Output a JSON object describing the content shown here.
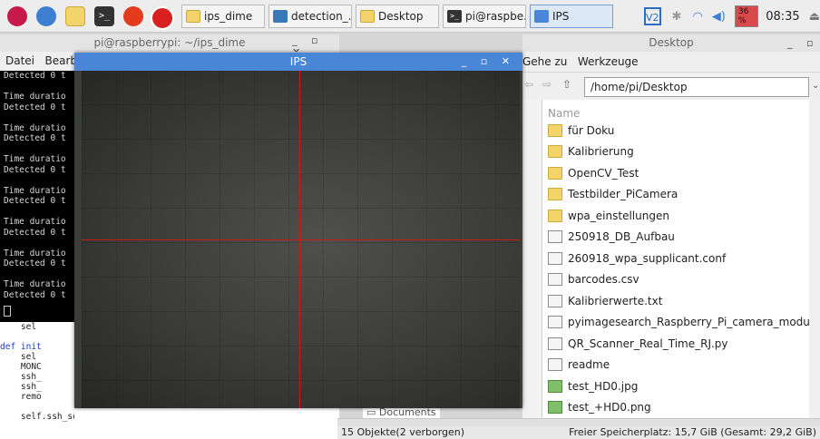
{
  "taskbar": {
    "buttons": [
      {
        "label": "ips_dime",
        "icon": "folder-icon"
      },
      {
        "label": "detection_...",
        "icon": "python-file-icon"
      },
      {
        "label": "Desktop",
        "icon": "folder-icon"
      },
      {
        "label": "pi@raspbe...",
        "icon": "terminal-icon"
      },
      {
        "label": "IPS",
        "icon": "window-icon"
      }
    ],
    "cpu": "36 %",
    "clock": "08:35"
  },
  "terminal": {
    "title": "pi@raspberrypi: ~/ips_dime",
    "menu": [
      "Datei",
      "Bearb"
    ],
    "output": [
      "Detected 0 t",
      "",
      "Time duratio",
      "Detected 0 t",
      "",
      "Time duratio",
      "Detected 0 t",
      "",
      "Time duratio",
      "Detected 0 t",
      "",
      "Time duratio",
      "Detected 0 t",
      "",
      "Time duratio",
      "Detected 0 t",
      "",
      "Time duratio",
      "Detected 0 t",
      "",
      "Time duratio",
      "Detected 0 t"
    ],
    "code": [
      "    sel",
      "",
      "def init",
      "    sel",
      "    MONC",
      "    ssh_",
      "    ssh_",
      "    remo",
      "",
      "    self.ssh_server.start()"
    ]
  },
  "ips": {
    "title": "IPS"
  },
  "filemanager": {
    "title": "Desktop",
    "menu": [
      "Gehe zu",
      "Werkzeuge"
    ],
    "path": "/home/pi/Desktop",
    "column_header": "Name",
    "files": [
      {
        "name": "für Doku",
        "type": "folder"
      },
      {
        "name": "Kalibrierung",
        "type": "folder"
      },
      {
        "name": "OpenCV_Test",
        "type": "folder"
      },
      {
        "name": "Testbilder_PiCamera",
        "type": "folder"
      },
      {
        "name": "wpa_einstellungen",
        "type": "folder"
      },
      {
        "name": "250918_DB_Aufbau",
        "type": "file"
      },
      {
        "name": "260918_wpa_supplicant.conf",
        "type": "file"
      },
      {
        "name": "barcodes.csv",
        "type": "file"
      },
      {
        "name": "Kalibrierwerte.txt",
        "type": "file"
      },
      {
        "name": "pyimagesearch_Raspberry_Pi_camera_module.py",
        "type": "file"
      },
      {
        "name": "QR_Scanner_Real_Time_RJ.py",
        "type": "file"
      },
      {
        "name": "readme",
        "type": "file"
      },
      {
        "name": "test_HD0.jpg",
        "type": "image"
      },
      {
        "name": "test_+HD0.png",
        "type": "image"
      }
    ],
    "side_item": "Documents",
    "status_left": "15 Objekte(2 verborgen)",
    "status_right": "Freier Speicherplatz: 15,7 GiB (Gesamt: 29,2 GiB)"
  }
}
